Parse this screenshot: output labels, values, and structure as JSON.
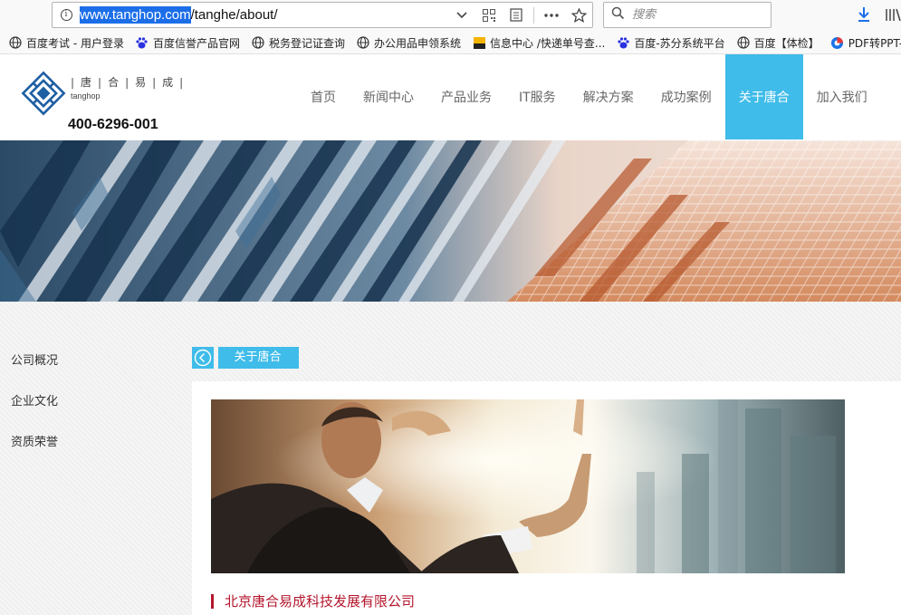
{
  "browser": {
    "url_highlight": "www.tanghop.com",
    "url_rest": "/tanghe/about/",
    "search_placeholder": "搜索",
    "bookmarks": [
      {
        "label": "百度考试 - 用户登录",
        "icon": "globe-icon"
      },
      {
        "label": "百度信誉产品官网",
        "icon": "baidu-paw-icon"
      },
      {
        "label": "税务登记证查询",
        "icon": "globe-icon"
      },
      {
        "label": "办公用品申领系统",
        "icon": "globe-icon"
      },
      {
        "label": "信息中心 /快递单号查...",
        "icon": "hpb-icon"
      },
      {
        "label": "百度-苏分系统平台",
        "icon": "baidu-paw-icon"
      },
      {
        "label": "百度【体检】",
        "icon": "globe-icon"
      },
      {
        "label": "PDF转PPT-",
        "icon": "pdf-icon"
      }
    ]
  },
  "site": {
    "logo_name": "|唐|合|易|成|",
    "logo_sub": "tanghop",
    "phone": "400-6296-001",
    "nav": [
      "首页",
      "新闻中心",
      "产品业务",
      "IT服务",
      "解决方案",
      "成功案例",
      "关于唐合",
      "加入我们"
    ],
    "nav_active": "关于唐合",
    "accent_color": "#3fbce9",
    "brand_red": "#b3162c"
  },
  "sidebar": {
    "items": [
      "公司概况",
      "企业文化",
      "资质荣誉"
    ]
  },
  "breadcrumb": {
    "label": "关于唐合"
  },
  "main": {
    "company_name": "北京唐合易成科技发展有限公司"
  }
}
